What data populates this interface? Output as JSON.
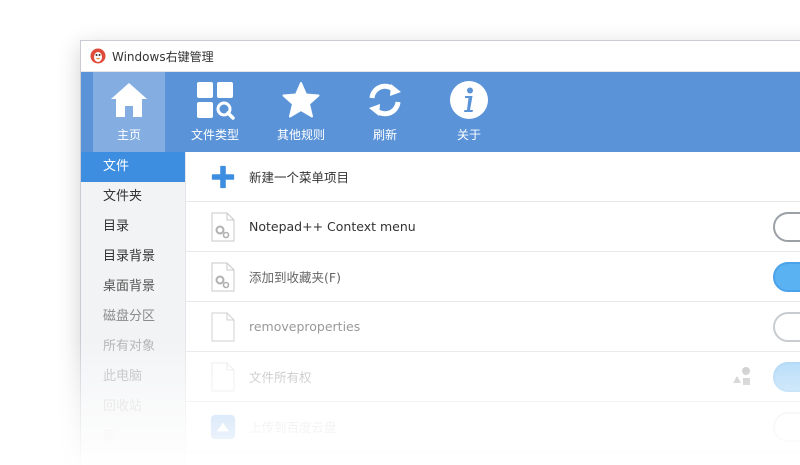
{
  "window": {
    "title": "Windows右键管理"
  },
  "toolbar": {
    "items": [
      {
        "label": "主页",
        "icon": "home-icon"
      },
      {
        "label": "文件类型",
        "icon": "file-type-search-icon"
      },
      {
        "label": "其他规则",
        "icon": "star-icon"
      },
      {
        "label": "刷新",
        "icon": "refresh-icon"
      },
      {
        "label": "关于",
        "icon": "info-icon"
      }
    ]
  },
  "sidebar": {
    "items": [
      {
        "label": "文件"
      },
      {
        "label": "文件夹"
      },
      {
        "label": "目录"
      },
      {
        "label": "目录背景"
      },
      {
        "label": "桌面背景"
      },
      {
        "label": "磁盘分区"
      },
      {
        "label": "所有对象"
      },
      {
        "label": "此电脑"
      },
      {
        "label": "回收站"
      },
      {
        "label": "库"
      }
    ]
  },
  "main": {
    "new_item_label": "新建一个菜单项目",
    "rows": [
      {
        "label": "Notepad++ Context menu",
        "icon": "gear-file-icon",
        "enabled": false
      },
      {
        "label": "添加到收藏夹(F)",
        "icon": "gear-file-icon",
        "enabled": true
      },
      {
        "label": "removeproperties",
        "icon": "blank-file-icon",
        "enabled": false
      },
      {
        "label": "文件所有权",
        "icon": "blank-file-icon",
        "enabled": true
      },
      {
        "label": "上传到百度云盘",
        "icon": "baidu-cloud-icon",
        "enabled": false
      }
    ]
  },
  "colors": {
    "toolbar_bg": "#5b93d8",
    "sidebar_active": "#3d8ee0",
    "toggle_on": "#5bb2f2"
  }
}
